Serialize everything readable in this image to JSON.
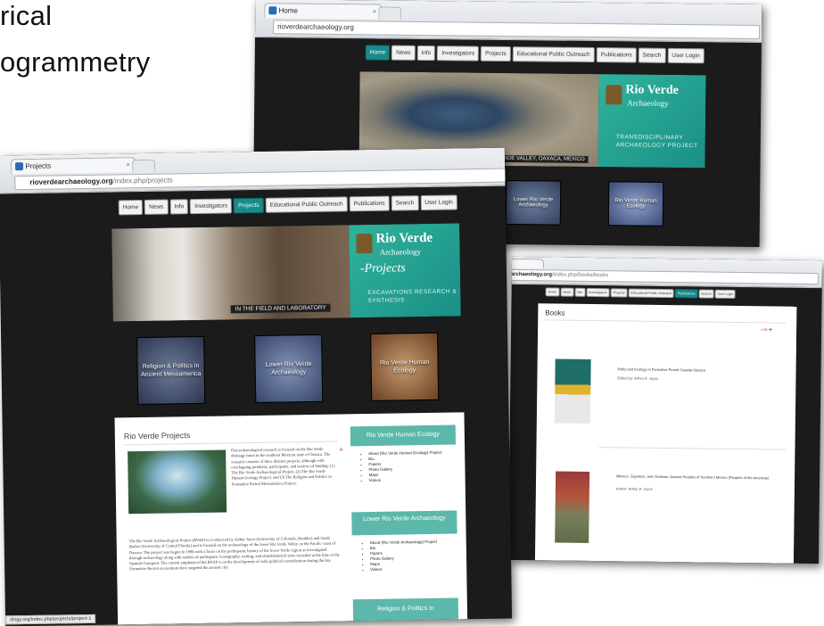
{
  "slide": {
    "line1": "rical",
    "line2": "ogrammetry"
  },
  "win_home": {
    "tab_title": "Home",
    "url": "rioverdearchaeology.org",
    "nav": [
      "Home",
      "News",
      "Info",
      "Investigators",
      "Projects",
      "Educational Public Outreach",
      "Publications",
      "Search",
      "User Login"
    ],
    "active_nav": 0,
    "banner_title": "Rio Verde",
    "banner_subtitle": "Archaeology",
    "banner_tagline": "TRANSDISCIPLINARY ARCHAEOLOGY PROJECT",
    "caption": "VERDE VALLEY, OAXACA, MEXICO",
    "thumbs": [
      "Lower Rio Verde Archaeology",
      "Rio Verde Human Ecology"
    ]
  },
  "win_projects": {
    "tab_title": "Projects",
    "url_domain": "rioverdearchaeology.org",
    "url_path": "/index.php/projects",
    "nav": [
      "Home",
      "News",
      "Info",
      "Investigators",
      "Projects",
      "Educational Public Outreach",
      "Publications",
      "Search",
      "User Login"
    ],
    "active_nav": 4,
    "banner_title": "Rio Verde",
    "banner_subtitle": "Archaeology",
    "banner_projects": "-Projects",
    "banner_tagline": "EXCAVATIONS RESEARCH & SYNTHESIS",
    "caption": "IN THE FIELD AND LABORATORY",
    "thumbs": [
      "Religion & Politics in Ancient Mesoamerica",
      "Lower Rio Verde Archaeology",
      "Rio Verde Human Ecology"
    ],
    "content_title": "Rio Verde Projects",
    "para1": "Our archaeological research is focused on the Rio Verde drainage basin in the southern Mexican state of Oaxaca. The research consists of three distinct projects, although with overlapping problems, participants, and sources of funding: (1) The Rio Verde Archaeological Project, (2) The Rio Verde Human Ecology Project, and (3) The Religion and Politics in Formative Period Mesoamerica Project.",
    "para2": "The Rio Verde Archaeological Project (RVAP) is co-directed by Arthur Joyce (University of Colorado, Boulder) and Sarah Barber (University of Central Florida) and is focused on the archaeology of the lower Rio Verde Valley on the Pacific coast of Oaxaca. The project was begun in 1986 with a focus on the prehispanic history of the lower Verde region as investigated through archaeology along with studies of prehispanic iconography, writing, and ethnohistorical texts recorded at the time of the Spanish Conquest. The current emphasis of the RVAP is on the development of early political centralization during the late Formative Recent excavations have targeted the ancient city",
    "side1_title": "Rio Verde Human Ecology",
    "side1_items": [
      "About (Rio Verde Human Ecology) Project",
      "Bio",
      "Papers",
      "Photo Gallery",
      "Maps",
      "Videos"
    ],
    "side2_title": "Lower Rio Verde Archaeology",
    "side2_items": [
      "About (Rio Verde Archaeology) Project",
      "Bio",
      "Papers",
      "Photo Gallery",
      "Maps",
      "Videos"
    ],
    "side3_title": "Religion & Politics in",
    "status": "ology.org/index.php/projects/project-1"
  },
  "win_books": {
    "url_domain": "archaeology.org",
    "url_path": "/index.php/books/books",
    "nav": [
      "Home",
      "News",
      "Info",
      "Investigators",
      "Projects",
      "Educational Public Outreach",
      "Publications",
      "Search",
      "User Login"
    ],
    "active_nav": 6,
    "page_title": "Books",
    "book1_title": "Polity and Ecology in Formative Period Coastal Oaxaca",
    "book1_author": "Edited by: Arthur A. Joyce",
    "book2_title": "Mixtecs, Zapotecs, and Chatinos: Ancient Peoples of Southern Mexico (Peoples of the Americas)",
    "book2_author": "Author: Arthur A. Joyce"
  },
  "colors": {
    "teal": "#1a8a8a",
    "page_bg": "#1b1b1b"
  }
}
